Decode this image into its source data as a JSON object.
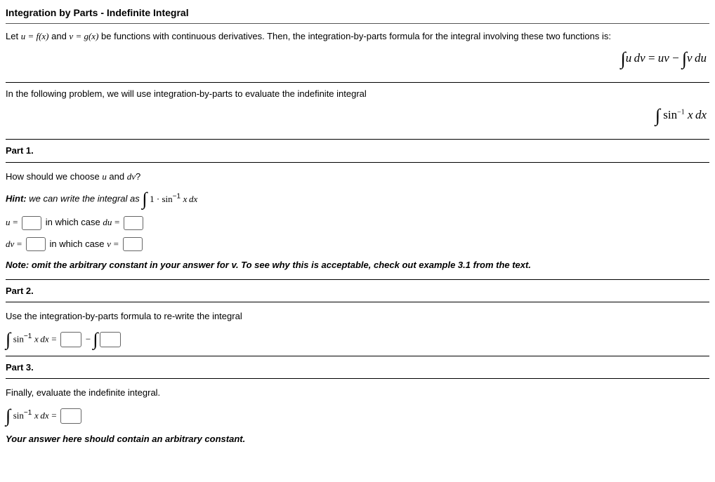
{
  "title": "Integration by Parts - Indefinite Integral",
  "intro1": "Let ",
  "intro2": " and ",
  "intro3": " be functions with continuous derivatives. Then, the integration-by-parts formula for the integral involving these two functions is:",
  "eq_ibp": "∫ u dv = uv − ∫ v du",
  "lead2": "In the following problem, we will use integration-by-parts to evaluate the indefinite integral",
  "eq_target": "∫ sin⁻¹ x dx",
  "part1": {
    "heading": "Part 1.",
    "q": "How should we choose ",
    "q2": " and ",
    "q3": "?",
    "hint_label": "Hint:",
    "hint_text": " we can write the integral as ",
    "hint_eq": "∫ 1 · sin⁻¹ x dx",
    "line_u1": "u = ",
    "line_u2": " in which case ",
    "line_u3": "du = ",
    "line_dv1": "dv = ",
    "line_dv2": " in which case ",
    "line_dv3": "v = ",
    "note": "Note: omit the arbitrary constant in your answer for v. To see why this is acceptable, check out example 3.1 from the text."
  },
  "part2": {
    "heading": "Part 2.",
    "text": "Use the integration-by-parts formula to re-write the integral",
    "eq_lhs": "∫ sin⁻¹ x dx = ",
    "minus": " − "
  },
  "part3": {
    "heading": "Part 3.",
    "text": "Finally, evaluate the indefinite integral.",
    "eq_lhs": "∫ sin⁻¹ x dx = ",
    "note": "Your answer here should contain an arbitrary constant."
  }
}
